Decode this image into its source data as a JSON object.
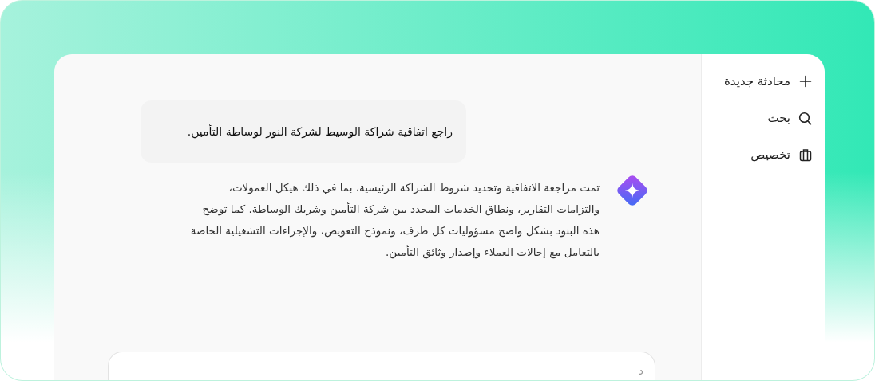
{
  "sidebar": {
    "items": [
      {
        "kind": "new",
        "label": "محادثة جديدة"
      },
      {
        "kind": "search",
        "label": "بحث"
      },
      {
        "kind": "customize",
        "label": "تخصيص"
      }
    ]
  },
  "chat": {
    "messages": [
      {
        "kind": "user",
        "text": "راجع اتفاقية شراكة الوسيط لشركة النور لوساطة التأمين."
      },
      {
        "kind": "assistant",
        "text": "تمت مراجعة الاتفاقية وتحديد شروط الشراكة الرئيسية، بما في ذلك هيكل العمولات، والتزامات التقارير، ونطاق الخدمات المحدد بين شركة التأمين وشريك الوساطة. كما توضح هذه البنود بشكل واضح مسؤوليات كل طرف، ونموذج التعويض، والإجراءات التشغيلية الخاصة بالتعامل مع إحالات العملاء وإصدار وثائق التأمين."
      }
    ],
    "composer": {
      "placeholder": "د"
    }
  }
}
